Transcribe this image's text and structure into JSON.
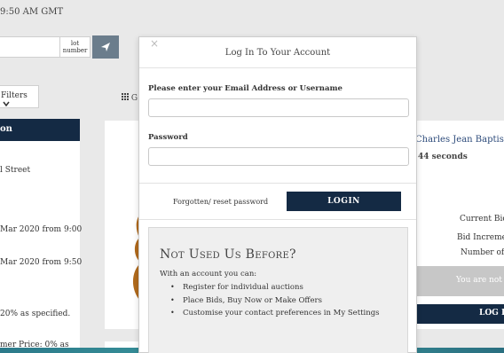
{
  "background": {
    "time_text": "9:50 AM GMT",
    "lot_number_label": "lot\nnumber",
    "filters_label": "Filters",
    "grid_label": "G",
    "left_panel": {
      "header": "on",
      "lines": [
        "l Street",
        "Mar 2020 from 9:00",
        "Mar 2020 from 9:50",
        "20% as specified.",
        "mer Price: 0% as"
      ]
    },
    "right_panel": {
      "title": "Charles Jean Baptiste Co",
      "countdown": "44 seconds",
      "current_bid_label": "Current Bid:",
      "bid_increment_label": "Bid Incremen",
      "number_of_label": "Number of l",
      "not_logged_text": "You are not lo",
      "login_label": "LOG IN"
    }
  },
  "modal": {
    "close_glyph": "×",
    "title": "Log In To Your Account",
    "email_label": "Please enter your Email Address or Username",
    "email_value": "",
    "password_label": "Password",
    "password_value": "",
    "forgot_label": "Forgotten/ reset password",
    "login_button": "LOGIN",
    "new_user": {
      "heading": "Not Used Us Before?",
      "intro": "With an account you can:",
      "bullets": [
        "Register for individual auctions",
        "Place Bids, Buy Now or Make Offers",
        "Customise your contact preferences in My Settings"
      ]
    }
  },
  "colors": {
    "navy": "#142a44",
    "send_button": "#6b7d8c",
    "page_background": "#e9e9e9"
  },
  "icons": [
    "send-icon",
    "chevron-down-icon",
    "grid-icon",
    "close-icon"
  ]
}
